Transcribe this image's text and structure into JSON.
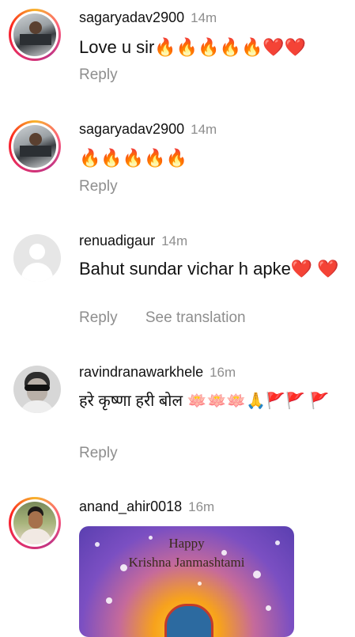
{
  "comments": [
    {
      "username": "sagaryadav2900",
      "time": "14m",
      "text": "Love u sir🔥🔥🔥🔥🔥❤️❤️",
      "actions": [
        "Reply"
      ]
    },
    {
      "username": "sagaryadav2900",
      "time": "14m",
      "text": "🔥🔥🔥🔥🔥",
      "actions": [
        "Reply"
      ]
    },
    {
      "username": "renuadigaur",
      "time": "14m",
      "text": "Bahut sundar vichar h apke❤️ ❤️",
      "actions": [
        "Reply",
        "See translation"
      ]
    },
    {
      "username": "ravindranawarkhele",
      "time": "16m",
      "text": "हरे कृष्णा हरी बोल 🪷🪷🪷🙏🚩🚩 🚩",
      "actions": [
        "Reply"
      ]
    },
    {
      "username": "anand_ahir0018",
      "time": "16m",
      "image_text": {
        "line1": "Happy",
        "line2": "Krishna Janmashtami"
      }
    }
  ],
  "colors": {
    "story_ring": "#e1306c",
    "secondary_text": "#8e8e8e"
  }
}
